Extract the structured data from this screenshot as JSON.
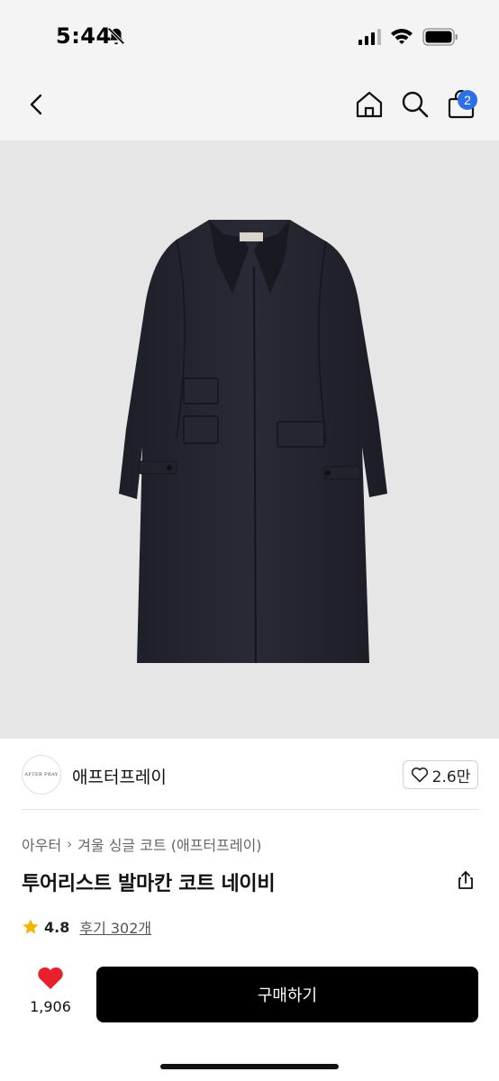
{
  "status": {
    "time": "5:44",
    "icons": [
      "bell-slash-icon",
      "signal-icon",
      "wifi-icon",
      "battery-icon"
    ]
  },
  "nav": {
    "icons": [
      "chevron-left-icon",
      "home-icon",
      "search-icon",
      "shopping-bag-icon"
    ],
    "cart_badge": "2",
    "badge_color": "#2f6fe6"
  },
  "brand": {
    "logo_text": "AFTER PRAY",
    "name": "애프터프레이",
    "like_count": "2.6만"
  },
  "product": {
    "breadcrumb": [
      "아우터",
      "겨울 싱글 코트 (애프터프레이)"
    ],
    "title": "투어리스트 발마칸 코트 네이비",
    "rating": "4.8",
    "reviews": "후기 302개",
    "coat_color": "#23232e"
  },
  "bottom": {
    "like_count": "1,906",
    "buy_label": "구매하기",
    "heart_color": "#e8202b",
    "button_color": "#000000"
  }
}
